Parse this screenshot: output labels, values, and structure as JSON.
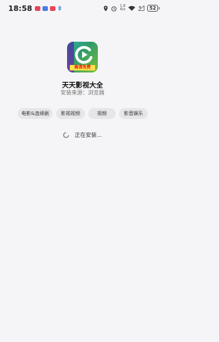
{
  "status_bar": {
    "time": "18:58",
    "net_speed_value": "1.6",
    "net_speed_unit": "K/s",
    "battery": "52",
    "icons": [
      "app-notification-icon",
      "app-notification-icon",
      "app-notification-icon",
      "bluetooth-icon",
      "location-icon",
      "alarm-icon",
      "wifi-icon",
      "no-sim-icon",
      "battery-icon"
    ]
  },
  "app": {
    "name": "天天影视大全",
    "source": "安装来源：浏览器",
    "badge": "高清免费",
    "icon": "video-play-icon",
    "colors": {
      "main": "#2f9a6a",
      "side": "#5a44a0",
      "badge_bg": "#ffe14a",
      "badge_text": "#e02020"
    }
  },
  "tags": [
    "电影&连续剧",
    "影视视频",
    "视频",
    "影音娱乐"
  ],
  "install": {
    "status": "正在安装..."
  }
}
